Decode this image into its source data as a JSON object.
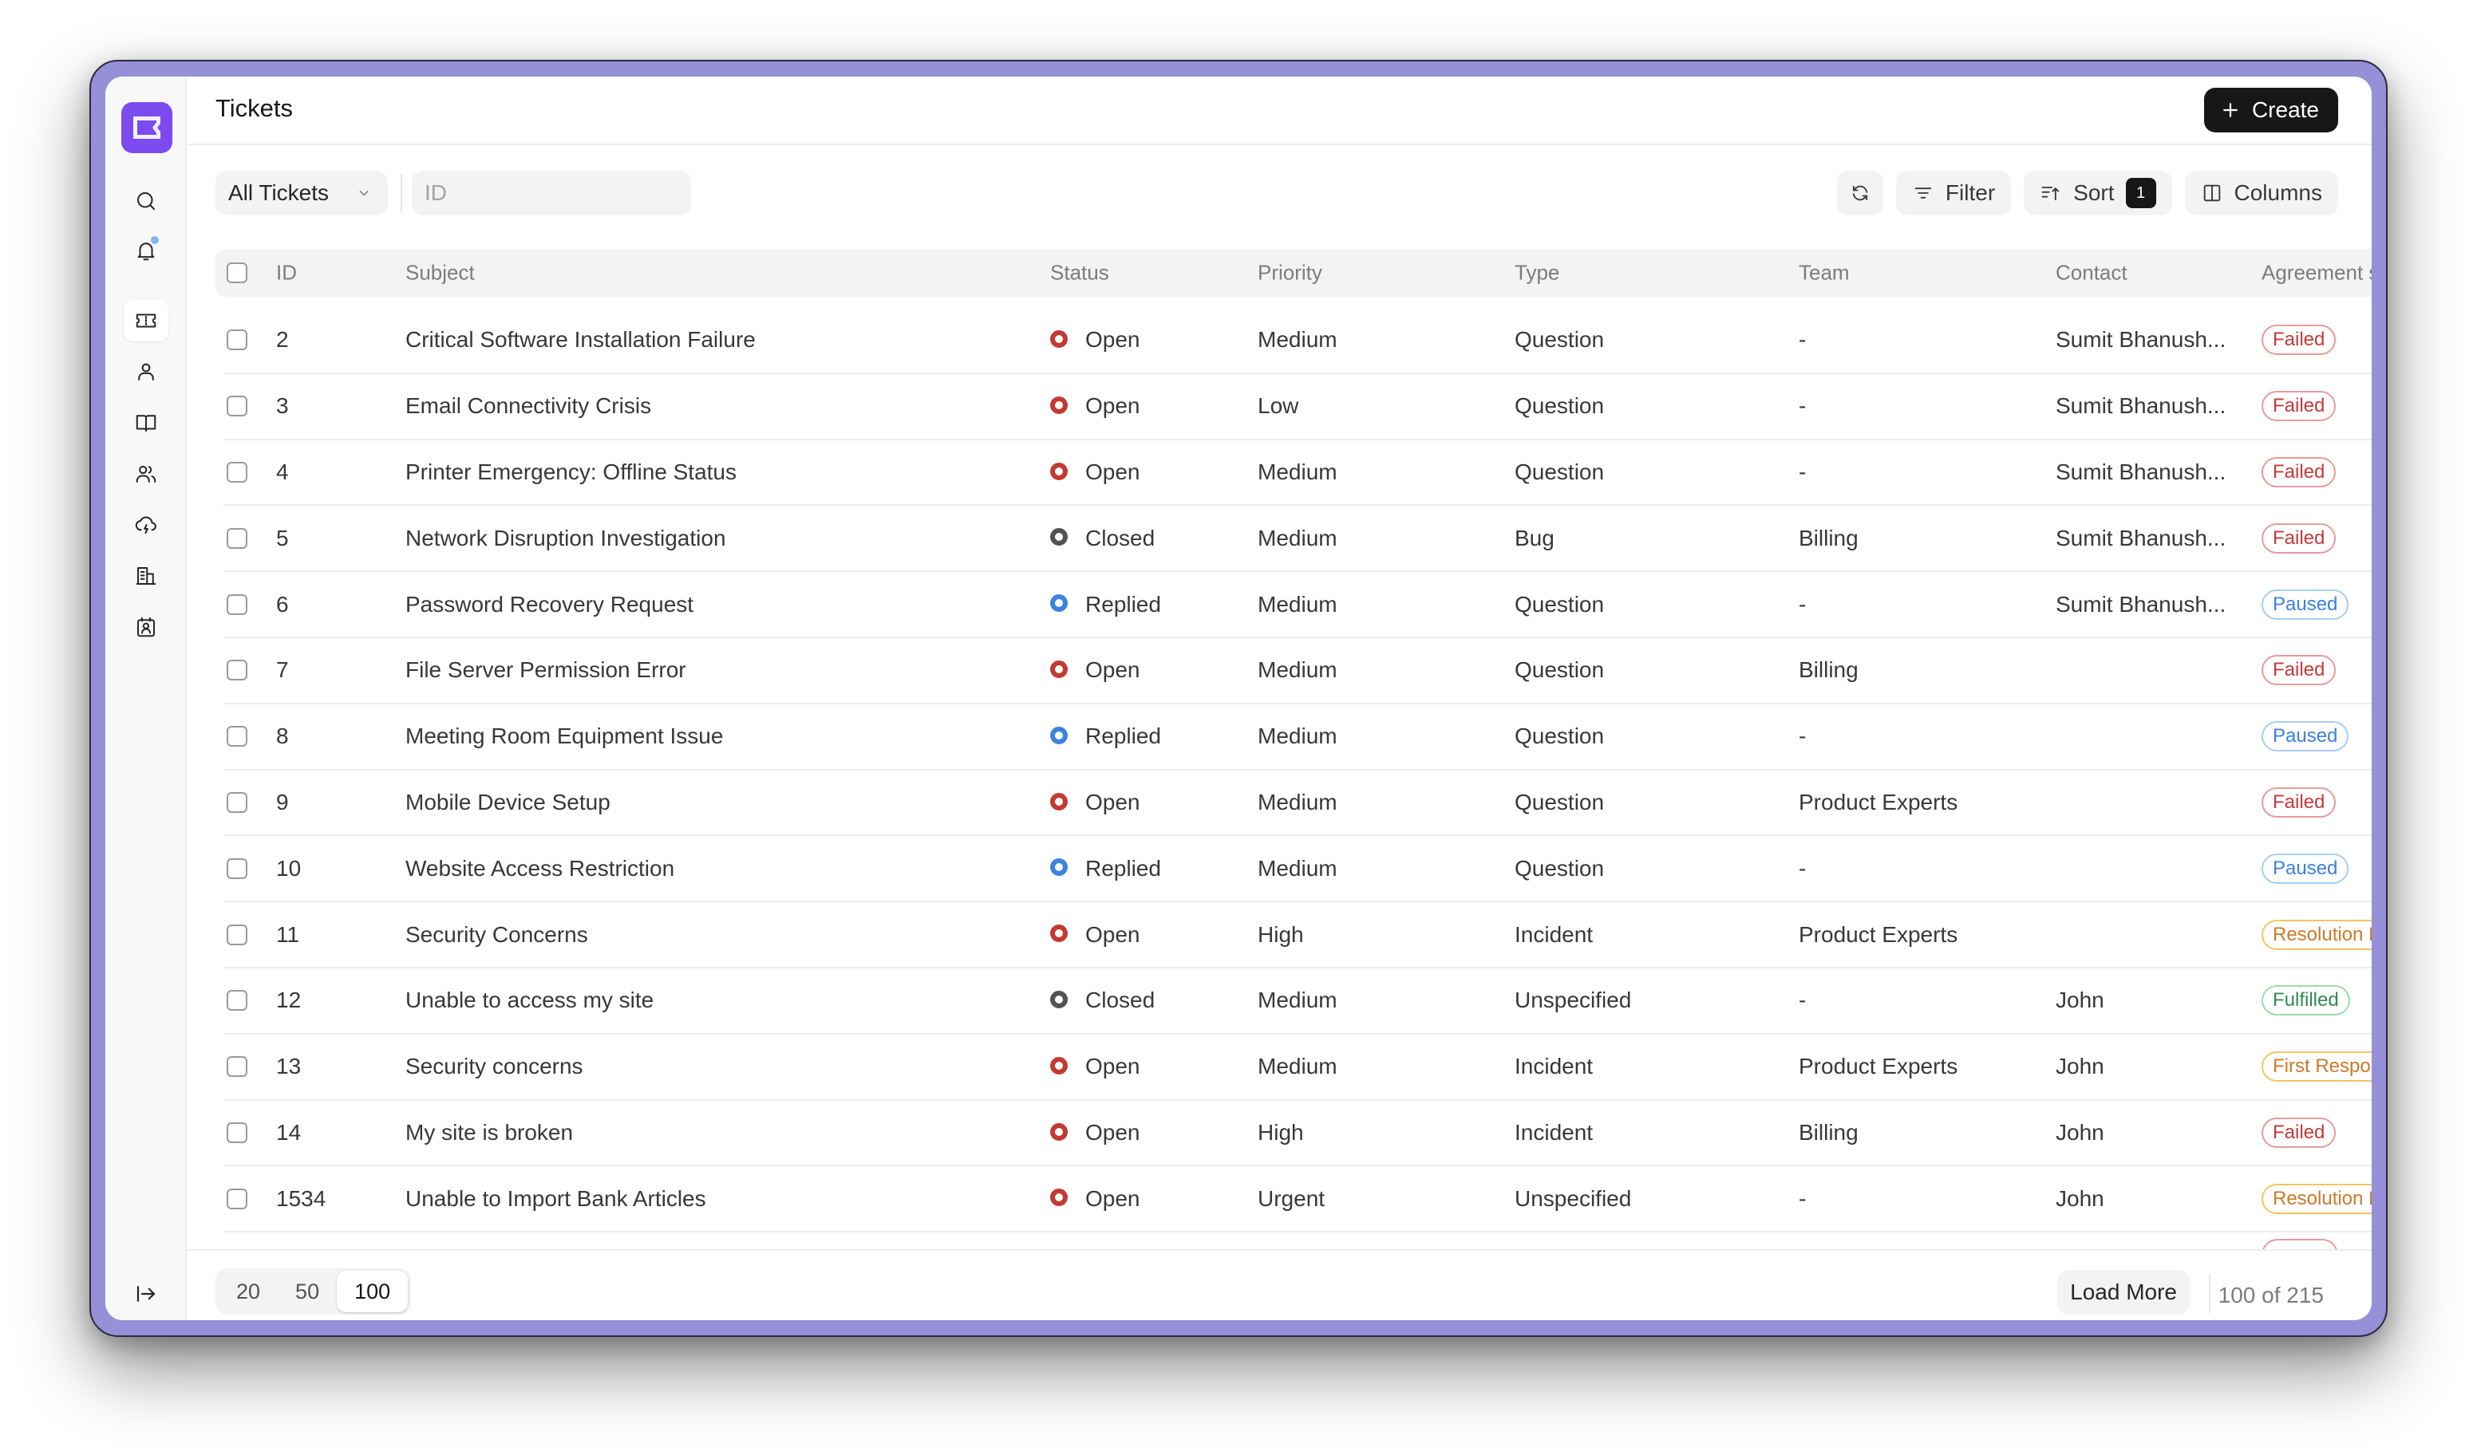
{
  "app": {
    "title": "Tickets",
    "accent_color": "#7c4bef",
    "frame_color": "#9690d8"
  },
  "sidebar": {
    "items": [
      {
        "name": "search",
        "icon": "search-icon"
      },
      {
        "name": "notifications",
        "icon": "bell-icon",
        "has_badge": true
      },
      {
        "name": "tickets",
        "icon": "ticket-icon",
        "active": true
      },
      {
        "name": "agents",
        "icon": "user-icon"
      },
      {
        "name": "knowledge-base",
        "icon": "book-open-icon"
      },
      {
        "name": "teams",
        "icon": "users-icon"
      },
      {
        "name": "escalation",
        "icon": "cloud-lightning-icon"
      },
      {
        "name": "customers",
        "icon": "building-icon"
      },
      {
        "name": "contacts",
        "icon": "contact-card-icon"
      }
    ],
    "collapse_icon": "collapse-sidebar-icon"
  },
  "header": {
    "create_label": "Create"
  },
  "toolbar": {
    "view_label": "All Tickets",
    "id_placeholder": "ID",
    "id_value": "",
    "filter_label": "Filter",
    "sort_label": "Sort",
    "sort_count": "1",
    "columns_label": "Columns"
  },
  "table": {
    "columns": [
      "ID",
      "Subject",
      "Status",
      "Priority",
      "Type",
      "Team",
      "Contact",
      "Agreement st"
    ],
    "rows": [
      {
        "id": "2",
        "subject": "Critical Software Installation Failure",
        "status": "Open",
        "priority": "Medium",
        "type": "Question",
        "team": "-",
        "contact": "Sumit Bhanush...",
        "agreement": "Failed"
      },
      {
        "id": "3",
        "subject": "Email Connectivity Crisis",
        "status": "Open",
        "priority": "Low",
        "type": "Question",
        "team": "-",
        "contact": "Sumit Bhanush...",
        "agreement": "Failed"
      },
      {
        "id": "4",
        "subject": "Printer Emergency: Offline Status",
        "status": "Open",
        "priority": "Medium",
        "type": "Question",
        "team": "-",
        "contact": "Sumit Bhanush...",
        "agreement": "Failed"
      },
      {
        "id": "5",
        "subject": "Network Disruption Investigation",
        "status": "Closed",
        "priority": "Medium",
        "type": "Bug",
        "team": "Billing",
        "contact": "Sumit Bhanush...",
        "agreement": "Failed"
      },
      {
        "id": "6",
        "subject": "Password Recovery Request",
        "status": "Replied",
        "priority": "Medium",
        "type": "Question",
        "team": "-",
        "contact": "Sumit Bhanush...",
        "agreement": "Paused"
      },
      {
        "id": "7",
        "subject": "File Server Permission Error",
        "status": "Open",
        "priority": "Medium",
        "type": "Question",
        "team": "Billing",
        "contact": "",
        "agreement": "Failed"
      },
      {
        "id": "8",
        "subject": "Meeting Room Equipment Issue",
        "status": "Replied",
        "priority": "Medium",
        "type": "Question",
        "team": "-",
        "contact": "",
        "agreement": "Paused"
      },
      {
        "id": "9",
        "subject": "Mobile Device Setup",
        "status": "Open",
        "priority": "Medium",
        "type": "Question",
        "team": "Product Experts",
        "contact": "",
        "agreement": "Failed"
      },
      {
        "id": "10",
        "subject": "Website Access Restriction",
        "status": "Replied",
        "priority": "Medium",
        "type": "Question",
        "team": "-",
        "contact": "",
        "agreement": "Paused"
      },
      {
        "id": "11",
        "subject": "Security Concerns",
        "status": "Open",
        "priority": "High",
        "type": "Incident",
        "team": "Product Experts",
        "contact": "",
        "agreement": "Resolution Due"
      },
      {
        "id": "12",
        "subject": "Unable to access my site",
        "status": "Closed",
        "priority": "Medium",
        "type": "Unspecified",
        "team": "-",
        "contact": "John",
        "agreement": "Fulfilled"
      },
      {
        "id": "13",
        "subject": "Security concerns",
        "status": "Open",
        "priority": "Medium",
        "type": "Incident",
        "team": "Product Experts",
        "contact": "John",
        "agreement": "First Response Due"
      },
      {
        "id": "14",
        "subject": "My site is broken",
        "status": "Open",
        "priority": "High",
        "type": "Incident",
        "team": "Billing",
        "contact": "John",
        "agreement": "Failed"
      },
      {
        "id": "1534",
        "subject": "Unable to Import Bank Articles",
        "status": "Open",
        "priority": "Urgent",
        "type": "Unspecified",
        "team": "-",
        "contact": "John",
        "agreement": "Resolution Due"
      }
    ],
    "status_colors": {
      "Open": "#c23a33",
      "Closed": "#525252",
      "Replied": "#3b82e0"
    },
    "agreement_styles": {
      "Failed": "failed",
      "Paused": "paused",
      "Fulfilled": "fulfilled",
      "Resolution Due": "warn",
      "First Response Due": "warn"
    }
  },
  "footer": {
    "page_sizes": [
      "20",
      "50",
      "100"
    ],
    "selected_page_size": "100",
    "load_more_label": "Load More",
    "count_text": "100 of 215"
  }
}
